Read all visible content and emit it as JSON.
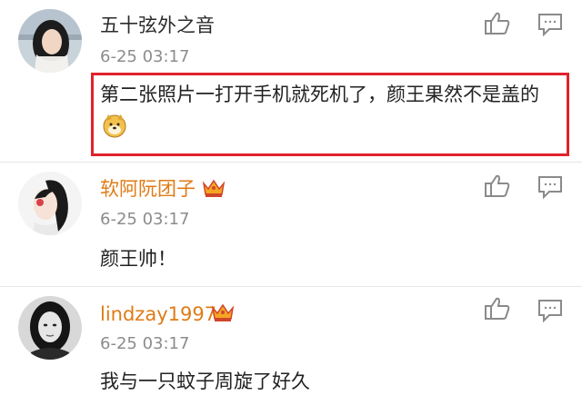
{
  "comments": [
    {
      "username": "五十弦外之音",
      "time": "6-25 03:17",
      "text": "第二张照片一打开手机就死机了，颜王果然不是盖的",
      "emoji": "doge-icon",
      "vip": false,
      "highlighted": true
    },
    {
      "username": "软阿阮团子",
      "time": "6-25 03:17",
      "text": "颜王帅！",
      "vip": true,
      "highlighted": false
    },
    {
      "username": "lindzay1997",
      "time": "6-25 03:17",
      "text": "我与一只蚊子周旋了好久",
      "vip": true,
      "highlighted": false
    }
  ],
  "colors": {
    "vip_name": "#e07b16",
    "highlight_border": "#e1222b",
    "timestamp": "#8c8c8c"
  },
  "icons": {
    "like": "thumbs-up-icon",
    "reply": "comment-reply-icon",
    "vip": "crown-icon"
  }
}
